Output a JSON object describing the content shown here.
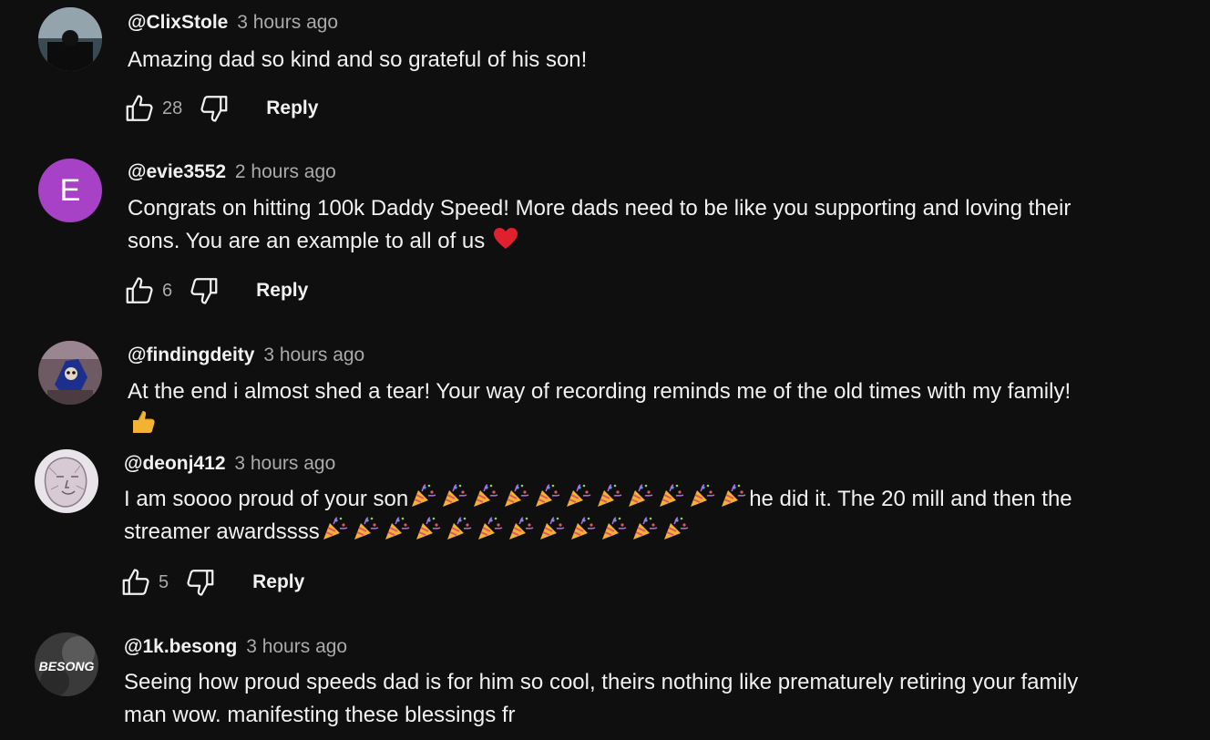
{
  "colors": {
    "background": "#0f0f0f",
    "text": "#f1f1f1",
    "muted": "#aaaaaa",
    "avatar_e": "#a742c6",
    "heart": "#e0202f",
    "thumbs_up_emoji": "#f2b233"
  },
  "comments": [
    {
      "author": "@ClixStole",
      "time": "3 hours ago",
      "text": "Amazing dad so kind and so grateful of his son!",
      "likes": "28",
      "reply_label": "Reply",
      "avatar": "photo-silhouette-icon"
    },
    {
      "author": "@evie3552",
      "time": "2 hours ago",
      "text_line1": "Congrats on hitting 100k Daddy Speed! More dads need to be like you supporting and loving their",
      "text_line2": "sons. You are an example to all of us",
      "emoji": "red-heart-icon",
      "likes": "6",
      "reply_label": "Reply",
      "avatar_letter": "E"
    },
    {
      "author": "@findingdeity",
      "time": "3 hours ago",
      "text": "At the end i almost shed a tear! Your way of recording reminds me of the old times with my family!",
      "emoji": "thumbs-up-emoji-icon",
      "avatar": "cartoon-character-icon"
    },
    {
      "author": "@deonj412",
      "time": "3 hours ago",
      "text_start": "I am soooo proud of your son",
      "text_mid": "he did it. The 20 mill and then the",
      "text_line2": "streamer awardssss",
      "emoji": "party-popper-icon",
      "emoji_count_line1": 11,
      "emoji_count_line2": 12,
      "likes": "5",
      "reply_label": "Reply",
      "avatar": "sketch-face-icon"
    },
    {
      "author": "@1k.besong",
      "time": "3 hours ago",
      "text_line1": "Seeing how proud speeds dad is for him so cool, theirs nothing like prematurely retiring your family",
      "text_line2": "man wow. manifesting these blessings fr",
      "avatar_text": "BESONG"
    }
  ]
}
